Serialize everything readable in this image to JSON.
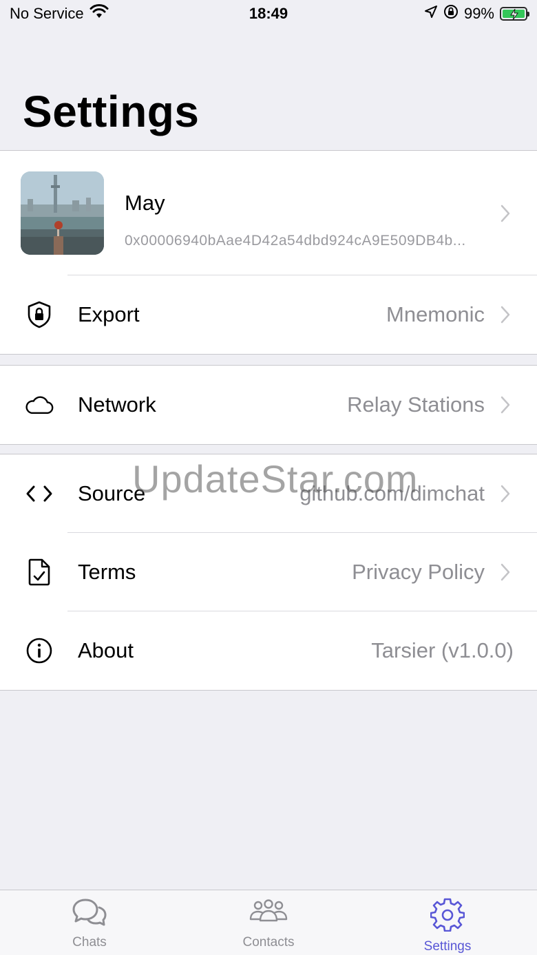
{
  "status_bar": {
    "carrier": "No Service",
    "time": "18:49",
    "battery": "99%"
  },
  "page_title": "Settings",
  "profile": {
    "name": "May",
    "address": "0x00006940bAae4D42a54dbd924cA9E509DB4b..."
  },
  "groups": [
    {
      "rows": [
        {
          "label": "Export",
          "value": "Mnemonic",
          "icon": "shield-lock-icon"
        }
      ]
    },
    {
      "rows": [
        {
          "label": "Network",
          "value": "Relay Stations",
          "icon": "cloud-icon"
        }
      ]
    },
    {
      "rows": [
        {
          "label": "Source",
          "value": "github.com/dimchat",
          "icon": "code-icon"
        },
        {
          "label": "Terms",
          "value": "Privacy Policy",
          "icon": "document-check-icon"
        },
        {
          "label": "About",
          "value": "Tarsier (v1.0.0)",
          "icon": "info-icon"
        }
      ]
    }
  ],
  "watermark": "UpdateStar.com",
  "tab_bar": {
    "tabs": [
      {
        "label": "Chats",
        "icon": "chat-bubbles-icon",
        "active": false
      },
      {
        "label": "Contacts",
        "icon": "people-icon",
        "active": false
      },
      {
        "label": "Settings",
        "icon": "gear-icon",
        "active": true
      }
    ]
  },
  "colors": {
    "accent": "#5856d6",
    "background": "#efeff4",
    "secondary_text": "#8e8e93"
  }
}
